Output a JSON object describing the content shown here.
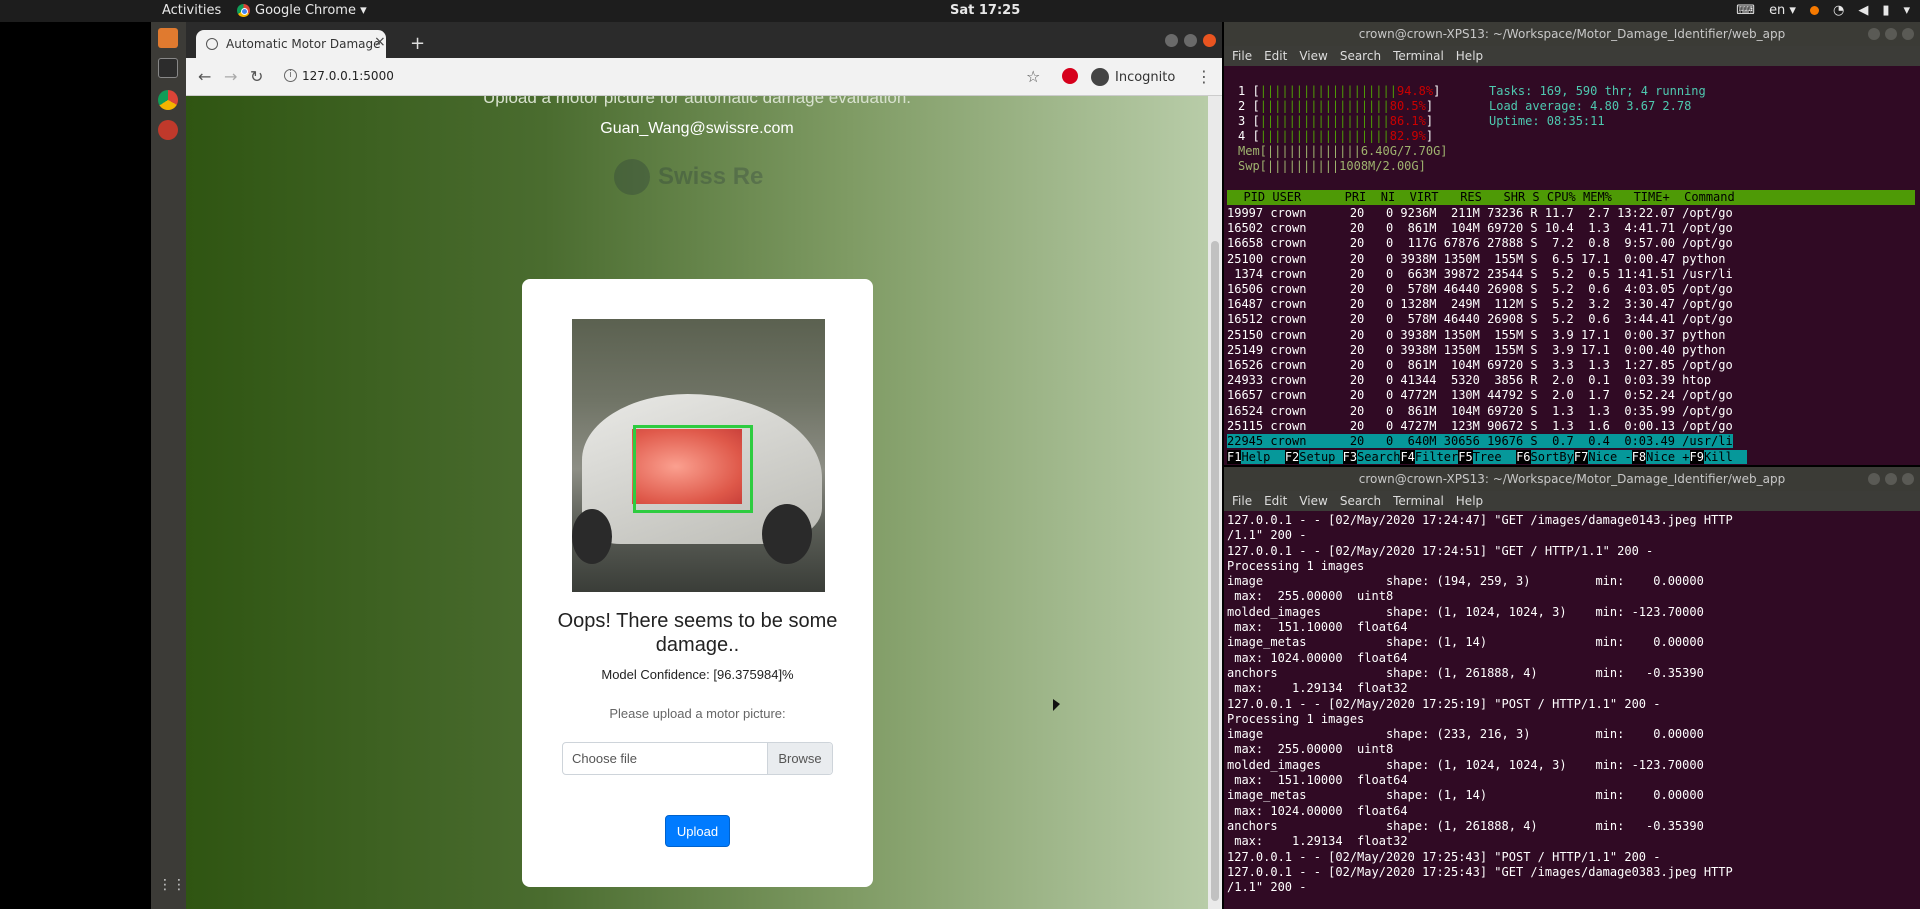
{
  "topbar": {
    "activities": "Activities",
    "app_name": "Google Chrome ▾",
    "clock": "Sat 17:25",
    "lang": "en ▾"
  },
  "browser": {
    "tab_title": "Automatic Motor Damage",
    "tab_close": "×",
    "new_tab": "+",
    "url": "127.0.0.1:5000",
    "incognito": "Incognito"
  },
  "page": {
    "intro": "Upload a motor picture for automatic damage evaluation.",
    "email": "Guan_Wang@swissre.com",
    "logo_text": "Swiss Re",
    "result_title": "Oops! There seems to be some damage..",
    "confidence": "Model Confidence: [96.375984]%",
    "prompt": "Please upload a motor picture:",
    "file_placeholder": "Choose file",
    "browse_label": "Browse",
    "upload_label": "Upload"
  },
  "term1": {
    "title": "crown@crown-XPS13: ~/Workspace/Motor_Damage_Identifier/web_app",
    "menu": [
      "File",
      "Edit",
      "View",
      "Search",
      "Terminal",
      "Help"
    ],
    "cpus": [
      {
        "n": "1",
        "bar": "|||||||||||||||||||",
        "pct": "94.8%"
      },
      {
        "n": "2",
        "bar": "||||||||||||||||||",
        "pct": "80.5%"
      },
      {
        "n": "3",
        "bar": "||||||||||||||||||",
        "pct": "86.1%"
      },
      {
        "n": "4",
        "bar": "||||||||||||||||||",
        "pct": "82.9%"
      }
    ],
    "mem": "Mem[|||||||||||||6.40G/7.70G]",
    "swp": "Swp[||||||||||1008M/2.00G]",
    "tasks": "Tasks: 169, 590 thr; 4 running",
    "load": "Load average: 4.80 3.67 2.78",
    "uptime": "Uptime: 08:35:11",
    "header": "  PID USER      PRI  NI  VIRT   RES   SHR S CPU% MEM%   TIME+  Command",
    "rows": [
      "19997 crown      20   0 9236M  211M 73236 R 11.7  2.7 13:22.07 /opt/go",
      "16502 crown      20   0  861M  104M 69720 S 10.4  1.3  4:41.71 /opt/go",
      "16658 crown      20   0  117G 67876 27888 S  7.2  0.8  9:57.00 /opt/go",
      "25100 crown      20   0 3938M 1350M  155M S  6.5 17.1  0:00.47 python",
      " 1374 crown      20   0  663M 39872 23544 S  5.2  0.5 11:41.51 /usr/li",
      "16506 crown      20   0  578M 46440 26908 S  5.2  0.6  4:03.05 /opt/go",
      "16487 crown      20   0 1328M  249M  112M S  5.2  3.2  3:30.47 /opt/go",
      "16512 crown      20   0  578M 46440 26908 S  5.2  0.6  3:44.41 /opt/go",
      "25150 crown      20   0 3938M 1350M  155M S  3.9 17.1  0:00.37 python",
      "25149 crown      20   0 3938M 1350M  155M S  3.9 17.1  0:00.40 python",
      "16526 crown      20   0  861M  104M 69720 S  3.3  1.3  1:27.85 /opt/go",
      "24933 crown      20   0 41344  5320  3856 R  2.0  0.1  0:03.39 htop",
      "16657 crown      20   0 4772M  130M 44792 S  2.0  1.7  0:52.24 /opt/go",
      "16524 crown      20   0  861M  104M 69720 S  1.3  1.3  0:35.99 /opt/go",
      "25115 crown      20   0 4727M  123M 90672 S  1.3  1.6  0:00.13 /opt/go",
      "22945 crown      20   0  640M 30656 19676 S  0.7  0.4  0:03.49 /usr/li"
    ],
    "fkeys": [
      {
        "k": "F1",
        "v": "Help  "
      },
      {
        "k": "F2",
        "v": "Setup "
      },
      {
        "k": "F3",
        "v": "Search"
      },
      {
        "k": "F4",
        "v": "Filter"
      },
      {
        "k": "F5",
        "v": "Tree  "
      },
      {
        "k": "F6",
        "v": "SortBy"
      },
      {
        "k": "F7",
        "v": "Nice -"
      },
      {
        "k": "F8",
        "v": "Nice +"
      },
      {
        "k": "F9",
        "v": "Kill  "
      }
    ]
  },
  "term2": {
    "title": "crown@crown-XPS13: ~/Workspace/Motor_Damage_Identifier/web_app",
    "menu": [
      "File",
      "Edit",
      "View",
      "Search",
      "Terminal",
      "Help"
    ],
    "log": "127.0.0.1 - - [02/May/2020 17:24:47] \"GET /images/damage0143.jpeg HTTP\n/1.1\" 200 -\n127.0.0.1 - - [02/May/2020 17:24:51] \"GET / HTTP/1.1\" 200 -\nProcessing 1 images\nimage                 shape: (194, 259, 3)         min:    0.00000\n max:  255.00000  uint8\nmolded_images         shape: (1, 1024, 1024, 3)    min: -123.70000\n max:  151.10000  float64\nimage_metas           shape: (1, 14)               min:    0.00000\n max: 1024.00000  float64\nanchors               shape: (1, 261888, 4)        min:   -0.35390\n max:    1.29134  float32\n127.0.0.1 - - [02/May/2020 17:25:19] \"POST / HTTP/1.1\" 200 -\nProcessing 1 images\nimage                 shape: (233, 216, 3)         min:    0.00000\n max:  255.00000  uint8\nmolded_images         shape: (1, 1024, 1024, 3)    min: -123.70000\n max:  151.10000  float64\nimage_metas           shape: (1, 14)               min:    0.00000\n max: 1024.00000  float64\nanchors               shape: (1, 261888, 4)        min:   -0.35390\n max:    1.29134  float32\n127.0.0.1 - - [02/May/2020 17:25:43] \"POST / HTTP/1.1\" 200 -\n127.0.0.1 - - [02/May/2020 17:25:43] \"GET /images/damage0383.jpeg HTTP\n/1.1\" 200 -"
  }
}
